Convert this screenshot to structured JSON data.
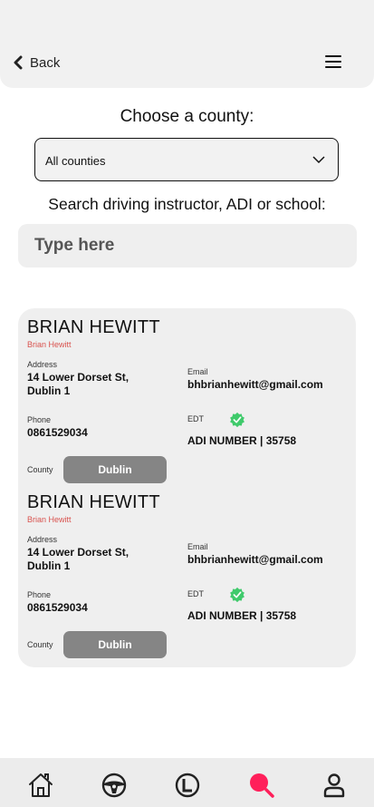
{
  "header": {
    "back_label": "Back"
  },
  "county": {
    "title": "Choose a county:",
    "selected": "All counties"
  },
  "search": {
    "title": "Search driving instructor, ADI or school:",
    "placeholder": "Type here"
  },
  "results": [
    {
      "name": "BRIAN HEWITT",
      "subname": "Brian Hewitt",
      "address_label": "Address",
      "address_line1": "14 Lower Dorset St,",
      "address_line2": "Dublin 1",
      "email_label": "Email",
      "email": "bhbrianhewitt@gmail.com",
      "phone_label": "Phone",
      "phone": "0861529034",
      "edt_label": "EDT",
      "adi": "ADI NUMBER | 35758",
      "county_label": "County",
      "county": "Dublin"
    },
    {
      "name": "BRIAN HEWITT",
      "subname": "Brian Hewitt",
      "address_label": "Address",
      "address_line1": "14 Lower Dorset St,",
      "address_line2": "Dublin 1",
      "email_label": "Email",
      "email": "bhbrianhewitt@gmail.com",
      "phone_label": "Phone",
      "phone": "0861529034",
      "edt_label": "EDT",
      "adi": "ADI NUMBER | 35758",
      "county_label": "County",
      "county": "Dublin"
    }
  ],
  "bottom_nav": {
    "items": [
      "home-icon",
      "steering-wheel-icon",
      "learner-plate-icon",
      "search-icon",
      "profile-icon"
    ],
    "active": "search-icon",
    "active_color": "#ff1f5a"
  },
  "colors": {
    "edt_check": "#3fca6b",
    "county_badge": "#858585",
    "subname": "#d9534f"
  }
}
